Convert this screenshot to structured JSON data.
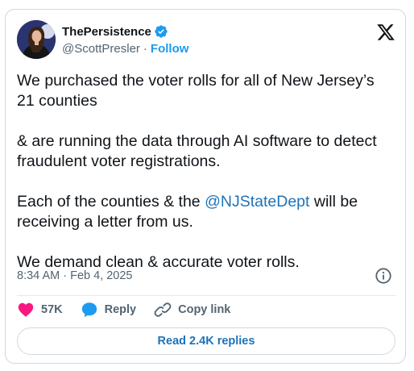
{
  "author": {
    "display_name": "ThePersistence",
    "handle": "@ScottPresler",
    "separator": "·",
    "follow_label": "Follow"
  },
  "tweet": {
    "paragraph1": "We purchased the voter rolls for all of New Jersey’s 21 counties",
    "paragraph2": "& are running the data through AI software to detect fraudulent voter registrations.",
    "paragraph3_before": "Each of the counties & the ",
    "paragraph3_mention": "@NJStateDept",
    "paragraph3_after": " will be receiving a letter from us.",
    "paragraph4": "We demand clean & accurate voter rolls."
  },
  "meta": {
    "timestamp": "8:34 AM · Feb 4, 2025"
  },
  "actions": {
    "like_count": "57K",
    "reply_label": "Reply",
    "copy_link_label": "Copy link"
  },
  "replies_button": {
    "label": "Read 2.4K replies"
  },
  "colors": {
    "accent": "#1d9bf0",
    "link": "#1d73b8",
    "like": "#f91880",
    "text": "#0f1419",
    "secondary": "#536471",
    "border": "#cfd9de"
  },
  "icons": {
    "brand": "x-logo-icon",
    "verified": "verified-badge-icon",
    "info": "info-icon",
    "like": "heart-icon",
    "reply": "speech-bubble-icon",
    "copy_link": "link-icon"
  }
}
